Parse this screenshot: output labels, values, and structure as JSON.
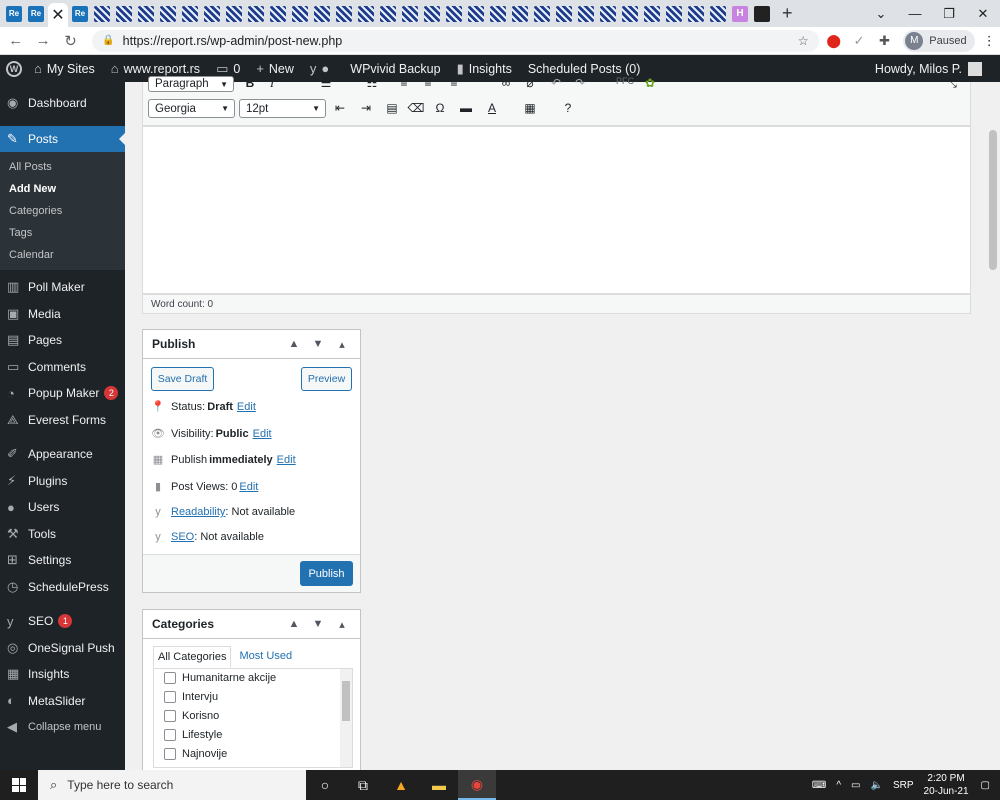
{
  "browser": {
    "tab_labels": [
      "Re",
      "Re",
      "",
      "Re"
    ],
    "address": "https://report.rs/wp-admin/post-new.php",
    "profile_initial": "M",
    "profile_status": "Paused"
  },
  "adminbar": {
    "my_sites": "My Sites",
    "site": "www.report.rs",
    "comments_count": "0",
    "new": "New",
    "backup": "WPvivid Backup",
    "insights": "Insights",
    "scheduled": "Scheduled Posts (0)",
    "howdy": "Howdy, Milos P."
  },
  "sidebar": {
    "dashboard": "Dashboard",
    "posts": "Posts",
    "submenu": [
      "All Posts",
      "Add New",
      "Categories",
      "Tags",
      "Calendar"
    ],
    "items": [
      {
        "label": "Poll Maker",
        "icon": "poll-icon"
      },
      {
        "label": "Media",
        "icon": "media-icon"
      },
      {
        "label": "Pages",
        "icon": "pages-icon"
      },
      {
        "label": "Comments",
        "icon": "comments-icon"
      },
      {
        "label": "Popup Maker",
        "icon": "popup-icon",
        "badge": "2"
      },
      {
        "label": "Everest Forms",
        "icon": "forms-icon"
      },
      {
        "label": "Appearance",
        "icon": "appearance-icon"
      },
      {
        "label": "Plugins",
        "icon": "plugins-icon"
      },
      {
        "label": "Users",
        "icon": "users-icon"
      },
      {
        "label": "Tools",
        "icon": "tools-icon"
      },
      {
        "label": "Settings",
        "icon": "settings-icon"
      },
      {
        "label": "SchedulePress",
        "icon": "schedule-icon"
      },
      {
        "label": "SEO",
        "icon": "seo-icon",
        "badge": "1"
      },
      {
        "label": "OneSignal Push",
        "icon": "onesignal-icon"
      },
      {
        "label": "Insights",
        "icon": "insights-icon"
      },
      {
        "label": "MetaSlider",
        "icon": "metaslider-icon"
      }
    ],
    "collapse": "Collapse menu"
  },
  "editor": {
    "format": "Paragraph",
    "font": "Georgia",
    "size": "12pt",
    "word_count": "Word count: 0"
  },
  "publish": {
    "title": "Publish",
    "save_draft": "Save Draft",
    "preview": "Preview",
    "status_label": "Status:",
    "status_value": "Draft",
    "visibility_label": "Visibility:",
    "visibility_value": "Public",
    "publish_label": "Publish",
    "publish_value": "immediately",
    "views_label": "Post Views:",
    "views_value": "0",
    "edit": "Edit",
    "readability_link": "Readability",
    "readability_value": ": Not available",
    "seo_link": "SEO",
    "seo_value": ": Not available",
    "publish_button": "Publish"
  },
  "categories": {
    "title": "Categories",
    "tab_all": "All Categories",
    "tab_used": "Most Used",
    "items": [
      "Humanitarne akcije",
      "Intervju",
      "Korisno",
      "Lifestyle",
      "Najnovije"
    ]
  },
  "taskbar": {
    "search": "Type here to search",
    "lang": "SRP",
    "time": "2:20 PM",
    "date": "20-Jun-21"
  }
}
